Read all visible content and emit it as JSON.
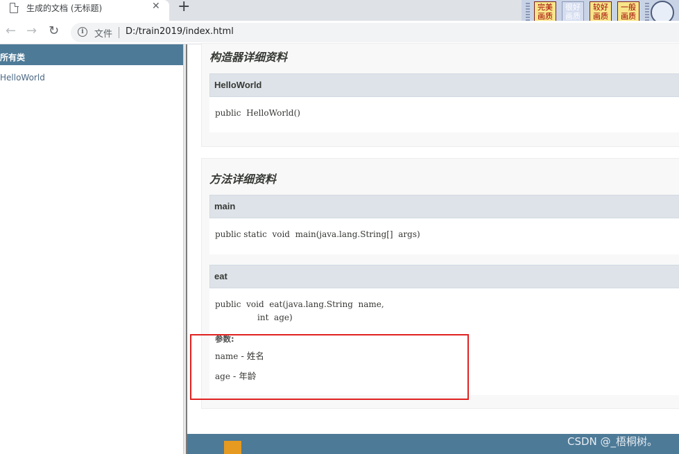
{
  "browser": {
    "tab_title": "生成的文档 (无标题)",
    "tab_close": "✕",
    "new_tab": "+",
    "address_scheme_label": "文件",
    "address_url": "D:/train2019/index.html",
    "nav_back": "←",
    "nav_forward": "→",
    "nav_reload": "↻",
    "info_icon_glyph": "i"
  },
  "extension_toolbar": {
    "badges": [
      "完美\n画质",
      "很好\n画质",
      "较好\n画质",
      "一般\n画质"
    ]
  },
  "sidebar": {
    "heading": "所有类",
    "classes": [
      "HelloWorld"
    ]
  },
  "content": {
    "constructor_section": {
      "heading": "构造器详细资料",
      "members": [
        {
          "name": "HelloWorld",
          "signature": "public  HelloWorld()"
        }
      ]
    },
    "method_section": {
      "heading": "方法详细资料",
      "members": [
        {
          "name": "main",
          "signature": "public static  void  main(java.lang.String[]  args)"
        },
        {
          "name": "eat",
          "signature_line1": "public  void  eat(java.lang.String  name,",
          "signature_line2": "                int  age)",
          "params_label": "参数:",
          "params": [
            {
              "name": "name",
              "desc": " - 姓名"
            },
            {
              "name": "age",
              "desc": " - 年龄"
            }
          ]
        }
      ]
    }
  },
  "watermark": "CSDN @_梧桐树。",
  "colors": {
    "nav_bar": "#4d7a97",
    "member_header": "#dee3e9",
    "annotation_box": "#e02020"
  }
}
